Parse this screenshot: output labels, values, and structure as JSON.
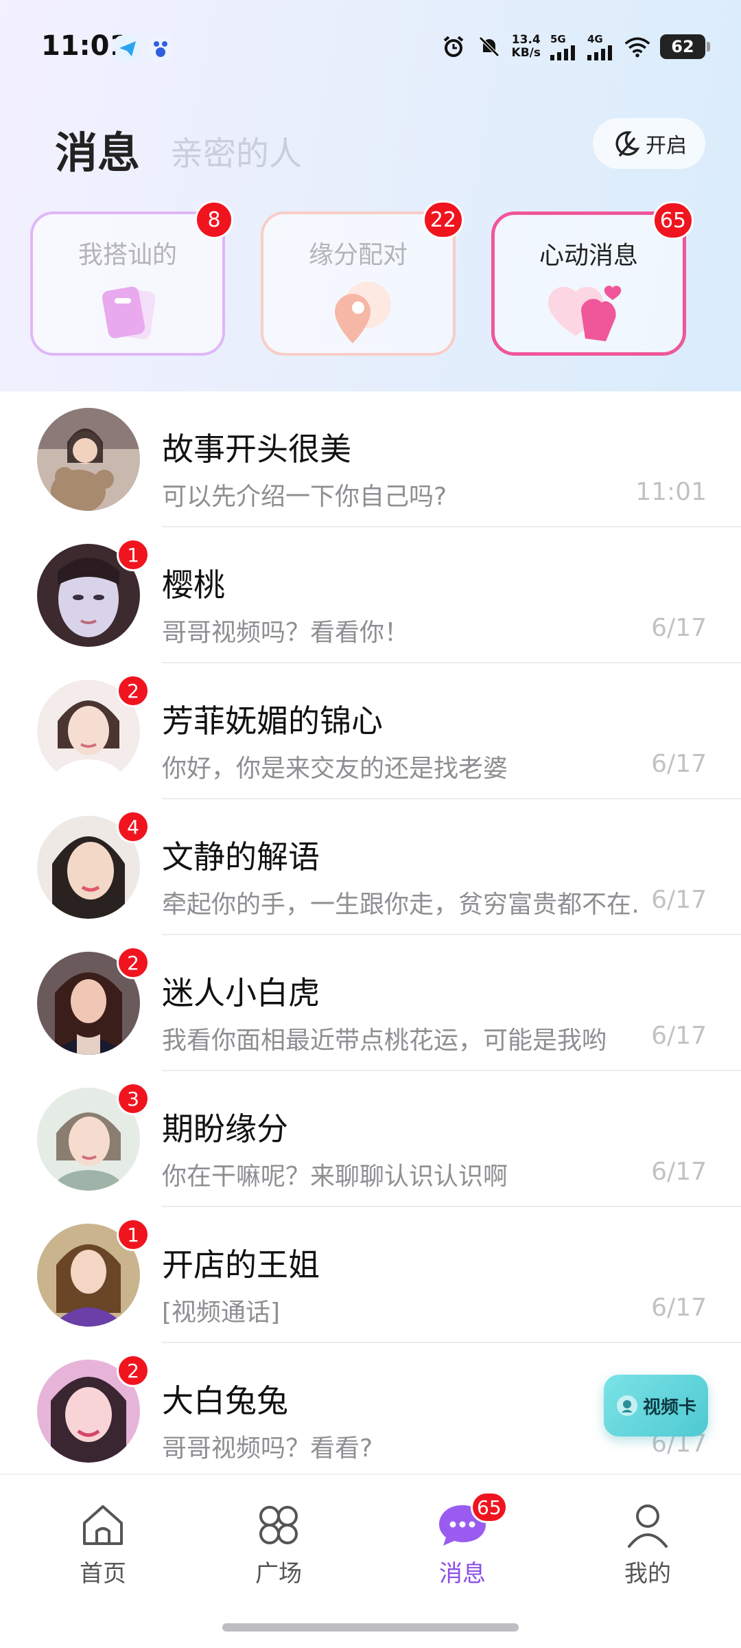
{
  "status_bar": {
    "time": "11:01",
    "speed_value": "13.4",
    "speed_unit": "KB/s",
    "net1": "5G",
    "net2": "4G",
    "battery": "62",
    "icons": [
      "telegram-icon",
      "baidu-icon",
      "alarm-icon",
      "mute-icon",
      "signal-icon",
      "wifi-icon"
    ]
  },
  "header": {
    "title": "消息",
    "secondary_tab": "亲密的人",
    "open_button": "开启"
  },
  "categories": [
    {
      "label": "我搭讪的",
      "badge": "8",
      "active": false
    },
    {
      "label": "缘分配对",
      "badge": "22",
      "active": false
    },
    {
      "label": "心动消息",
      "badge": "65",
      "active": true
    }
  ],
  "chats": [
    {
      "name": "故事开头很美",
      "preview": "可以先介绍一下你自己吗?",
      "time": "11:01",
      "unread": ""
    },
    {
      "name": "樱桃",
      "preview": "哥哥视频吗？看看你！",
      "time": "6/17",
      "unread": "1"
    },
    {
      "name": "芳菲妩媚的锦心",
      "preview": "你好，你是来交友的还是找老婆",
      "time": "6/17",
      "unread": "2"
    },
    {
      "name": "文静的解语",
      "preview": "牵起你的手，一生跟你走，贫穷富贵都不在…",
      "time": "6/17",
      "unread": "4"
    },
    {
      "name": "迷人小白虎",
      "preview": "我看你面相最近带点桃花运，可能是我哟",
      "time": "6/17",
      "unread": "2"
    },
    {
      "name": "期盼缘分",
      "preview": "你在干嘛呢？来聊聊认识认识啊",
      "time": "6/17",
      "unread": "3"
    },
    {
      "name": "开店的王姐",
      "preview": "[视频通话]",
      "time": "6/17",
      "unread": "1"
    },
    {
      "name": "大白兔兔",
      "preview": "哥哥视频吗？看看?",
      "time": "6/17",
      "unread": "2"
    }
  ],
  "floating": {
    "video_card": "视频卡"
  },
  "bottom_nav": [
    {
      "label": "首页",
      "icon": "home-icon"
    },
    {
      "label": "广场",
      "icon": "plaza-icon"
    },
    {
      "label": "消息",
      "icon": "message-icon",
      "badge": "65",
      "active": true
    },
    {
      "label": "我的",
      "icon": "profile-icon"
    }
  ],
  "colors": {
    "accent": "#8a4ee6",
    "badge": "#f0141f",
    "pink": "#f0569a"
  }
}
